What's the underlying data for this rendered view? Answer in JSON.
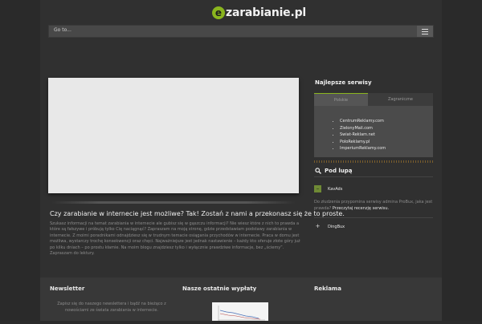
{
  "header": {
    "logo_letter": "e",
    "logo_text": "zarabianie.pl",
    "nav_label": "Go to..."
  },
  "article": {
    "title": "Czy zarabianie w internecie jest możliwe? Tak! Zostań z nami a przekonasz się że to proste.",
    "body": "Szukasz informacji na temat zarabiania w internecie ale gubisz się w gąszczu informacji? Nie wiesz które z nich to prawda a które są fałszywe i próbują tylko Cię naciągnąć? Zapraszam na moją stronę, gdzie przedstawiam podstawy zarabiania w internecie. Z moimi poradnikami odnajdziesz się w trudnym temacie osiągania przychodów w internecie. Praca w domu jest możliwa, wystarczy trochę konsekwencji oraz chęci. Najważniejsze jest jednak nastawienie – każdy kto oferuje złote góry już po kilku dniach – po prostu kłamie. Na moim blogu znajdziesz tylko i wyłącznie prawdziwe informacje, bez „ściemy”. Zapraszam do lektury."
  },
  "sidebar": {
    "best_title": "Najlepsze serwisy",
    "tabs": [
      {
        "label": "Polskie"
      },
      {
        "label": "Zagraniczne"
      }
    ],
    "services": [
      "CentrumReklamy.com",
      "ZielonyMail.com",
      "Swiat-Reklam.net",
      "PoloReklamy.pl",
      "ImperiumReklamy.com"
    ],
    "magnifier_title": "Pod lupą",
    "items": [
      {
        "toggle": "–",
        "label": "KavAds"
      },
      {
        "toggle": "+",
        "label": "DingBux"
      }
    ],
    "kavads_desc": "Do złudzenia przypomina serwisy admina ProBux, jaka jest prawda? ",
    "kavads_link": "Przeczytaj recenzję serwisu."
  },
  "footer": {
    "newsletter_title": "Newsletter",
    "newsletter_text": "Zapisz się do naszego newslettera i bądź na bieżąco z nowościami ze świata zarabiania w internecie.",
    "payouts_title": "Nasze ostatnie wypłaty",
    "ads_title": "Reklama"
  },
  "colors": {
    "accent_green": "#8ab51e",
    "stripe_gold": "#7a5e2c"
  }
}
